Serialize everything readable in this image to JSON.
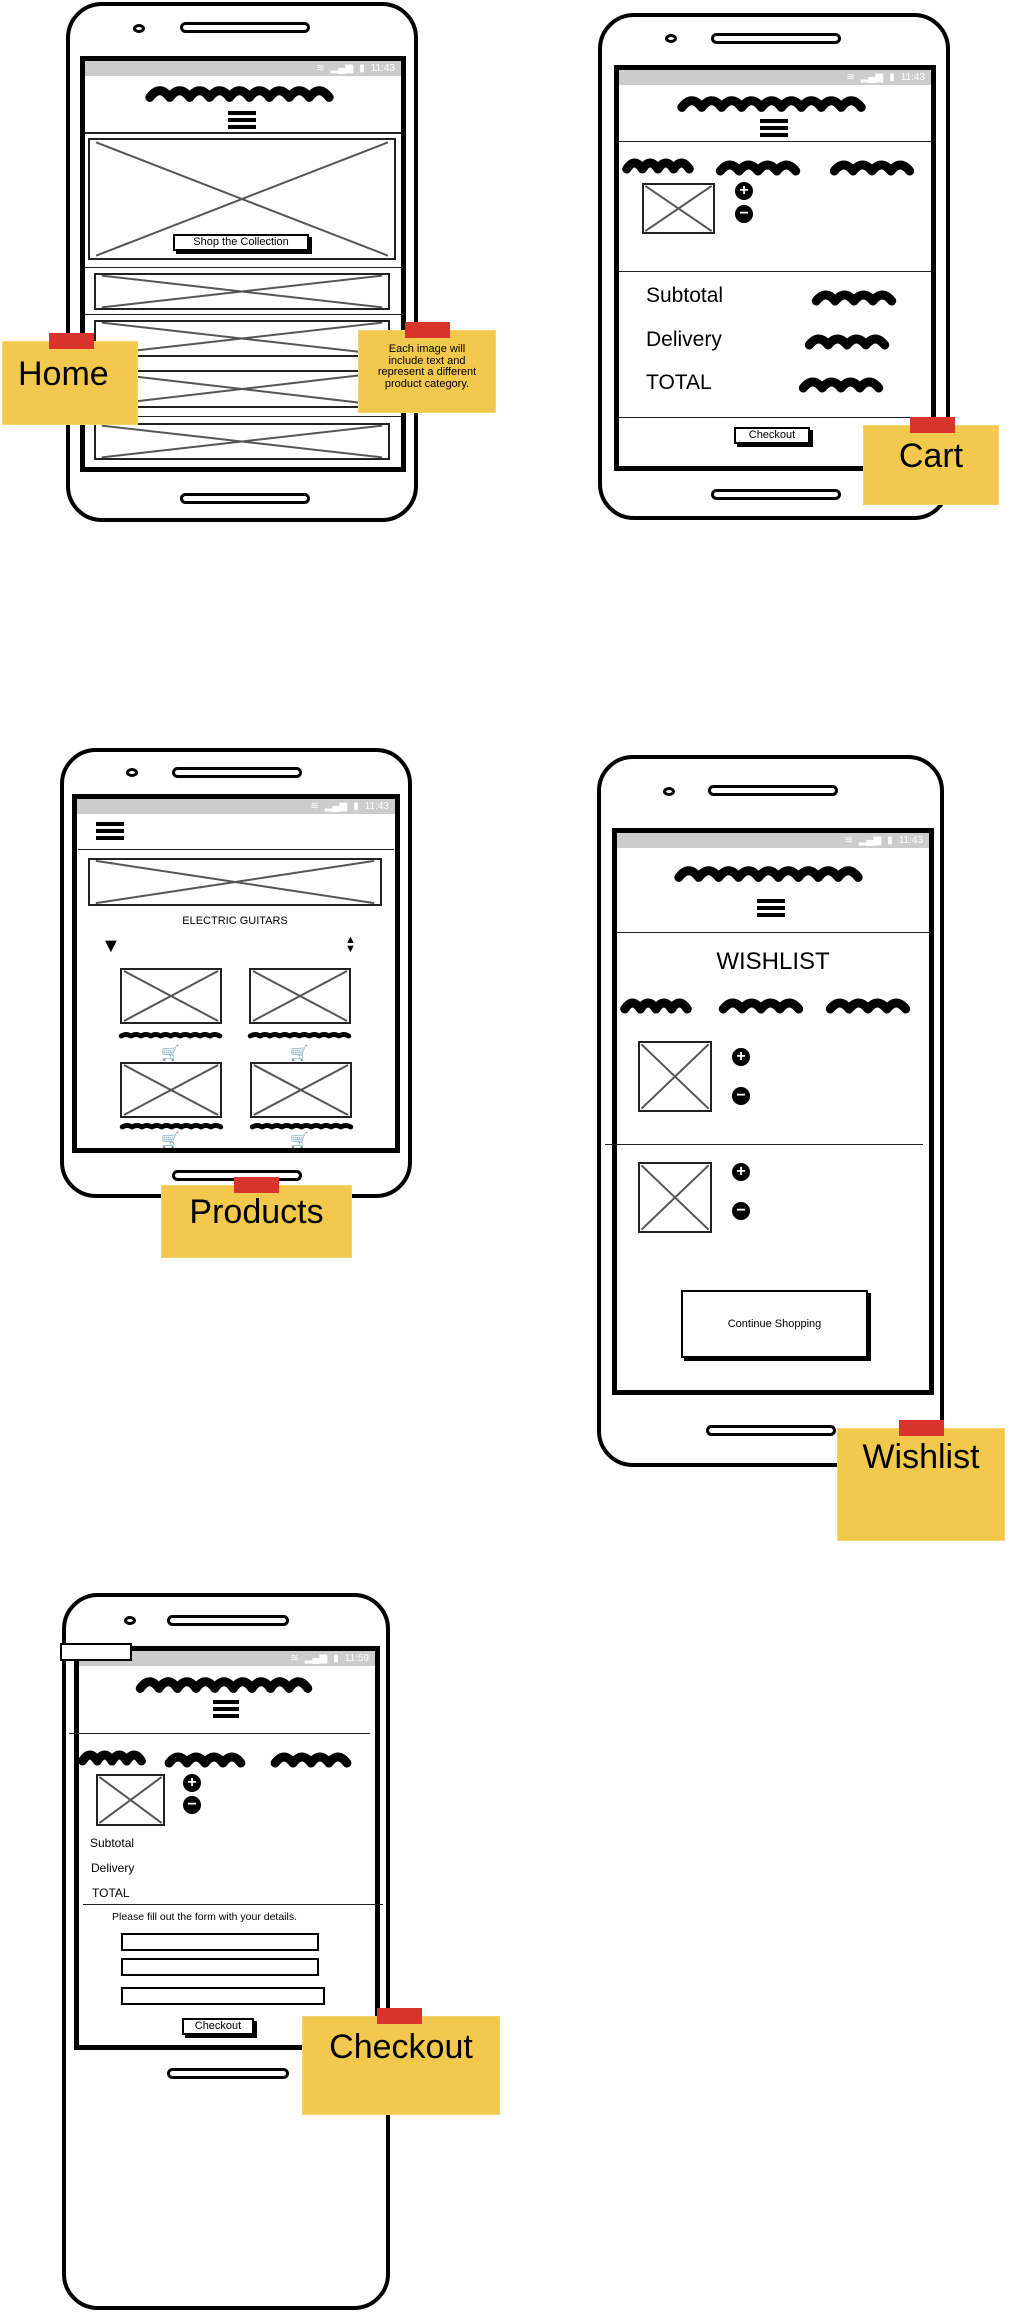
{
  "colors": {
    "note": "#f2c94c",
    "tape": "#d9342b",
    "status_bar": "#cccccc",
    "placeholder_x": "#555555"
  },
  "home": {
    "status_time": "11:43",
    "hero_button": "Shop the Collection",
    "note_title": "Home",
    "note_comment": "Each image will include text and represent a different product category.",
    "icons": [
      "wifi-icon",
      "signal-icon",
      "battery-icon",
      "hamburger-menu-icon",
      "image-placeholder-icon"
    ]
  },
  "cart": {
    "status_time": "11:43",
    "subtotal_label": "Subtotal",
    "delivery_label": "Delivery",
    "total_label": "TOTAL",
    "checkout_button": "Checkout",
    "note_title": "Cart",
    "icons": [
      "plus-circle-icon",
      "minus-circle-icon"
    ]
  },
  "products": {
    "status_time": "11:43",
    "category_title": "ELECTRIC GUITARS",
    "note_title": "Products",
    "icons": [
      "filter-icon",
      "sort-icon",
      "add-to-cart-icon"
    ]
  },
  "wishlist": {
    "status_time": "11:43",
    "title": "WISHLIST",
    "continue_button": "Continue Shopping",
    "note_title": "Wishlist"
  },
  "checkout": {
    "status_time": "11:59",
    "subtotal_label": "Subtotal",
    "delivery_label": "Delivery",
    "total_label": "TOTAL",
    "form_instruction": "Please fill out the form with your details.",
    "checkout_button": "Checkout",
    "note_title": "Checkout"
  }
}
